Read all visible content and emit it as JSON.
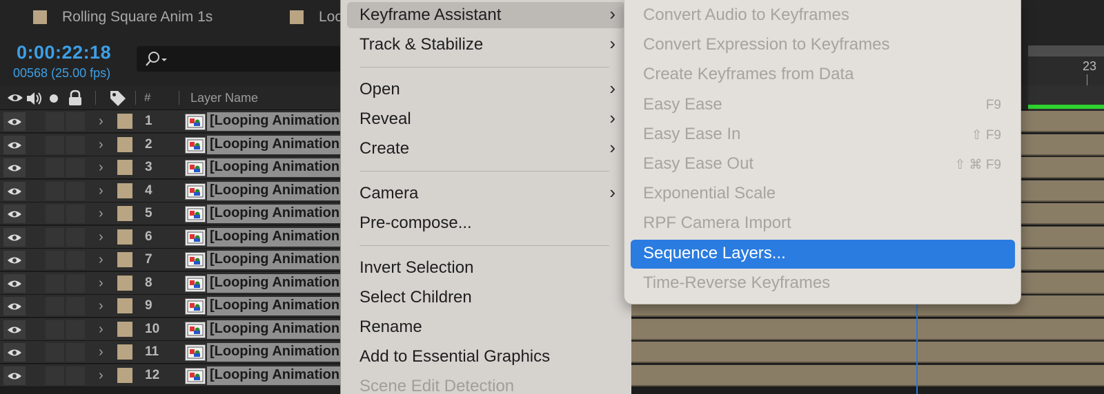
{
  "tabs": [
    {
      "label": "Rolling Square Anim 1s"
    },
    {
      "label": "Loo"
    }
  ],
  "timeline": {
    "timecode": "0:00:22:18",
    "frames": "00568 (25.00 fps)",
    "ruler_label": "23",
    "column_hash": "#",
    "column_layer_name": "Layer Name"
  },
  "layers": [
    {
      "num": "1",
      "name": "[Looping Animation"
    },
    {
      "num": "2",
      "name": "[Looping Animation"
    },
    {
      "num": "3",
      "name": "[Looping Animation"
    },
    {
      "num": "4",
      "name": "[Looping Animation"
    },
    {
      "num": "5",
      "name": "[Looping Animation"
    },
    {
      "num": "6",
      "name": "[Looping Animation"
    },
    {
      "num": "7",
      "name": "[Looping Animation"
    },
    {
      "num": "8",
      "name": "[Looping Animation"
    },
    {
      "num": "9",
      "name": "[Looping Animation"
    },
    {
      "num": "10",
      "name": "[Looping Animation"
    },
    {
      "num": "11",
      "name": "[Looping Animation"
    },
    {
      "num": "12",
      "name": "[Looping Animation"
    }
  ],
  "context_menu": {
    "items": [
      {
        "label": "Keyframe Assistant",
        "has_submenu": true,
        "state": "hover"
      },
      {
        "label": "Track & Stabilize",
        "has_submenu": true
      },
      {
        "label": "Open",
        "has_submenu": true
      },
      {
        "label": "Reveal",
        "has_submenu": true
      },
      {
        "label": "Create",
        "has_submenu": true
      },
      {
        "label": "Camera",
        "has_submenu": true
      },
      {
        "label": "Pre-compose...",
        "has_submenu": false
      },
      {
        "label": "Invert Selection",
        "has_submenu": false
      },
      {
        "label": "Select Children",
        "has_submenu": false
      },
      {
        "label": "Rename",
        "has_submenu": false
      },
      {
        "label": "Add to Essential Graphics",
        "has_submenu": false
      },
      {
        "label": "Scene Edit Detection",
        "has_submenu": false,
        "state": "disabled"
      }
    ]
  },
  "submenu": {
    "items": [
      {
        "label": "Convert Audio to Keyframes",
        "shortcut": ""
      },
      {
        "label": "Convert Expression to Keyframes",
        "shortcut": ""
      },
      {
        "label": "Create Keyframes from Data",
        "shortcut": ""
      },
      {
        "label": "Easy Ease",
        "shortcut": "F9"
      },
      {
        "label": "Easy Ease In",
        "shortcut": "⇧ F9"
      },
      {
        "label": "Easy Ease Out",
        "shortcut": "⇧ ⌘ F9"
      },
      {
        "label": "Exponential Scale",
        "shortcut": ""
      },
      {
        "label": "RPF Camera Import",
        "shortcut": ""
      },
      {
        "label": "Sequence Layers...",
        "shortcut": "",
        "state": "active"
      },
      {
        "label": "Time-Reverse Keyframes",
        "shortcut": ""
      }
    ]
  },
  "colors": {
    "accent": "#2a7ce0",
    "timecode": "#3d9fe6",
    "label_sandstone": "#b9a583",
    "work_area_green": "#2fd22f"
  }
}
